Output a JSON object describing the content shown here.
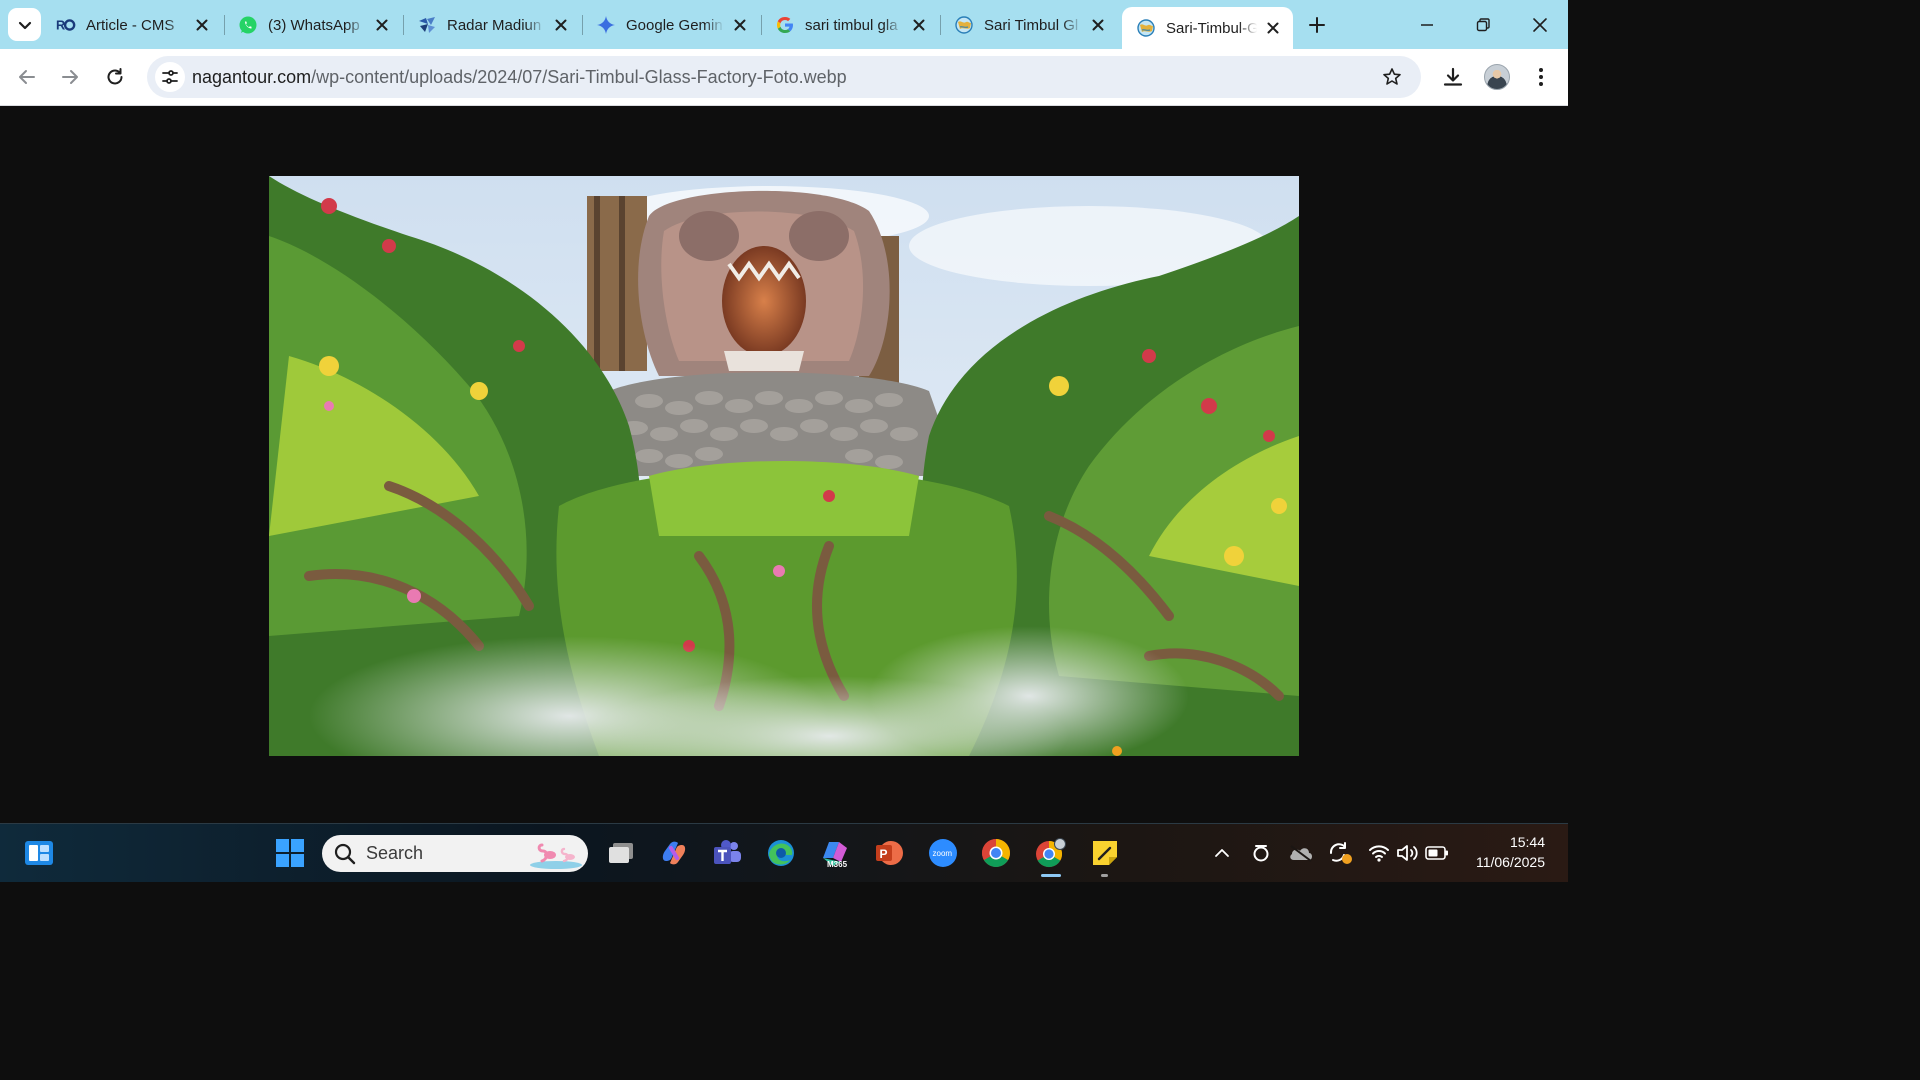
{
  "browser": {
    "tabs": [
      {
        "title": "Article - CMS",
        "icon": "ro-logo-icon",
        "active": false
      },
      {
        "title": "(3) WhatsApp",
        "icon": "whatsapp-icon",
        "active": false
      },
      {
        "title": "Radar Madiun",
        "icon": "radar-madiun-icon",
        "active": false
      },
      {
        "title": "Google Gemini",
        "icon": "gemini-icon",
        "active": false
      },
      {
        "title": "sari timbul gla",
        "icon": "google-icon",
        "active": false
      },
      {
        "title": "Sari Timbul Gl",
        "icon": "globe-icon",
        "active": false
      },
      {
        "title": "Sari-Timbul-G",
        "icon": "globe-icon",
        "active": true
      }
    ],
    "address": {
      "host": "nagantour.com",
      "path": "/wp-content/uploads/2024/07/Sari-Timbul-Glass-Factory-Foto.webp"
    }
  },
  "taskbar": {
    "search_placeholder": "Search",
    "apps": [
      "task-view-icon",
      "copilot-icon",
      "teams-icon",
      "edge-icon",
      "m365-icon",
      "powerpoint-icon",
      "zoom-icon",
      "chrome-icon",
      "chrome-profile-icon",
      "sticky-notes-icon"
    ],
    "m365_label": "M365",
    "zoom_label": "zoom",
    "powerpoint_label": "P",
    "time": "15:44",
    "date": "11/06/2025"
  },
  "colors": {
    "tabstrip": "#a6dff0",
    "toolbar": "#ffffff",
    "page_bg": "#0e0e0e",
    "omnibox": "#e9eef6"
  }
}
